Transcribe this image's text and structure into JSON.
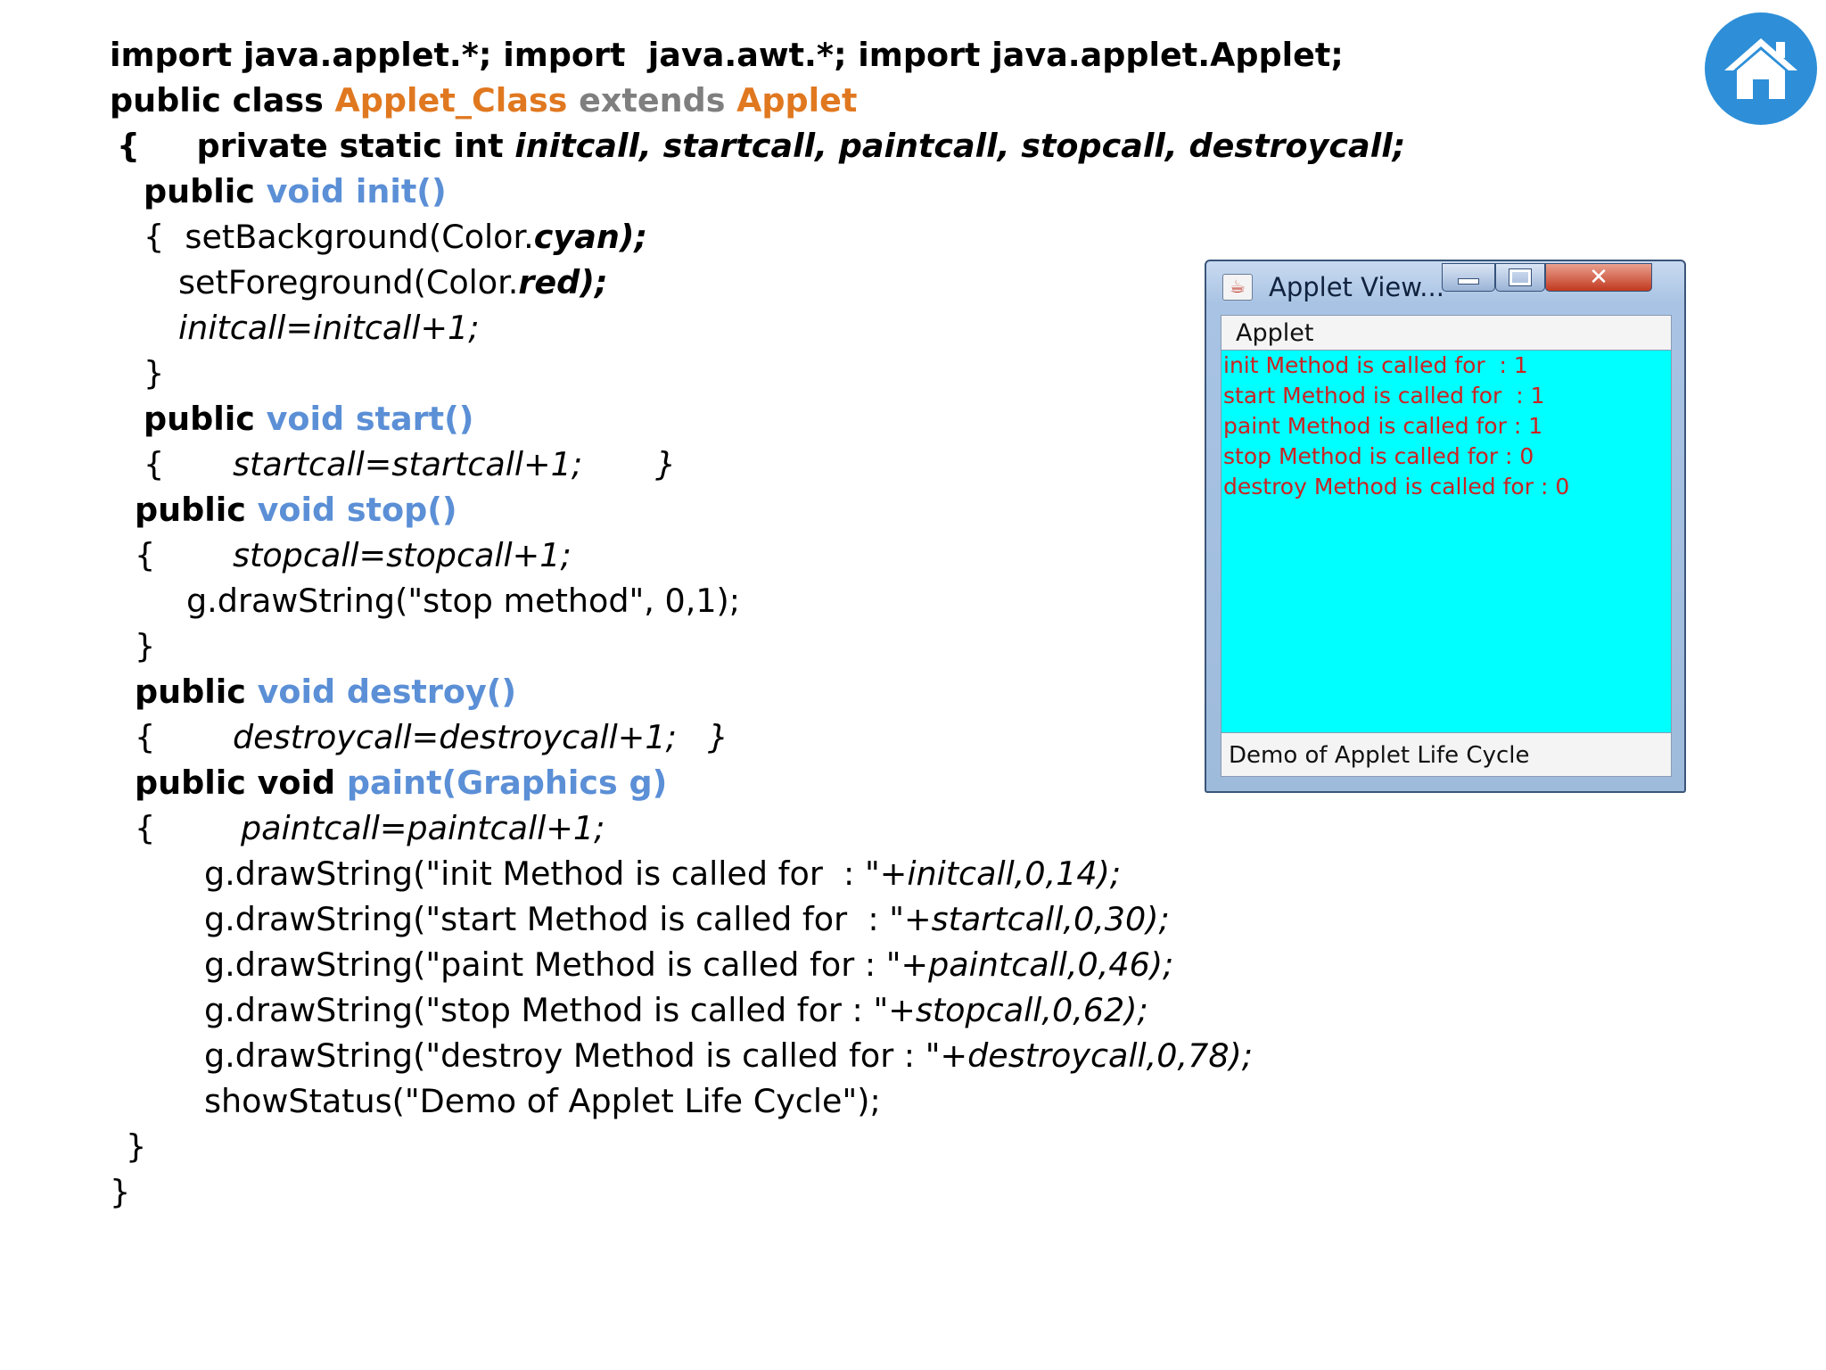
{
  "code": {
    "l1": "import java.applet.*; import  java.awt.*; import java.applet.Applet;",
    "l2": {
      "a": "public class ",
      "b": "Applet_Class",
      "c": " extends ",
      "d": "Applet"
    },
    "l3": {
      "a": "{     private static int ",
      "b": "initcall, startcall, paintcall, stopcall, destroycall;"
    },
    "l4": {
      "a": "public ",
      "b": "void init()"
    },
    "l5": {
      "a": "{  setBackground(Color.",
      "b": "cyan);"
    },
    "l6": {
      "a": "setForeground(Color.",
      "b": "red);"
    },
    "l7": "initcall=initcall+1;",
    "l8": "}",
    "l9": {
      "a": "public ",
      "b": "void start()"
    },
    "l10": {
      "a": "{",
      "b": "startcall=startcall+1;",
      "c": "}"
    },
    "l11": {
      "a": "public ",
      "b": "void stop()"
    },
    "l12": {
      "a": "{",
      "b": "stopcall=stopcall+1;"
    },
    "l13": "g.drawString(\"stop method\", 0,1);",
    "l14": "}",
    "l15": {
      "a": "public ",
      "b": "void destroy()"
    },
    "l16": {
      "a": "{",
      "b": "destroycall=destroycall+1;   }"
    },
    "l17": {
      "a": "public void ",
      "b": "paint(Graphics g)"
    },
    "l18": {
      "a": "{",
      "b": "paintcall=paintcall+1;"
    },
    "l19": {
      "a": "g.drawString(\"init Method is called for  : \"+",
      "b": "initcall,0,14);"
    },
    "l20": {
      "a": "g.drawString(\"start Method is called for  : \"+",
      "b": "startcall,0,30);"
    },
    "l21": {
      "a": "g.drawString(\"paint Method is called for : \"+",
      "b": "paintcall,0,46);"
    },
    "l22": {
      "a": "g.drawString(\"stop Method is called for : \"+",
      "b": "stopcall,0,62);"
    },
    "l23": {
      "a": "g.drawString(\"destroy Method is called for : \"+",
      "b": "destroycall,0,78);"
    },
    "l24": "showStatus(\"Demo of Applet Life Cycle\");",
    "l25": "}",
    "l26": "}"
  },
  "applet_window": {
    "title": "Applet View...",
    "close_glyph": "✕",
    "menu": "Applet",
    "output": [
      "init Method is called for  : 1",
      "start Method is called for  : 1",
      "paint Method is called for : 1",
      "stop Method is called for : 0",
      "destroy Method is called for : 0"
    ],
    "status": "Demo of Applet Life Cycle"
  },
  "colors": {
    "keyword_blue": "#5b8fd6",
    "class_orange": "#e07820",
    "extends_gray": "#7f7f7f",
    "applet_background": "#00ffff",
    "applet_foreground": "#cc2222",
    "home_button": "#2e8fd8"
  },
  "icons": {
    "home": "home-icon",
    "java": "java-cup-icon"
  }
}
